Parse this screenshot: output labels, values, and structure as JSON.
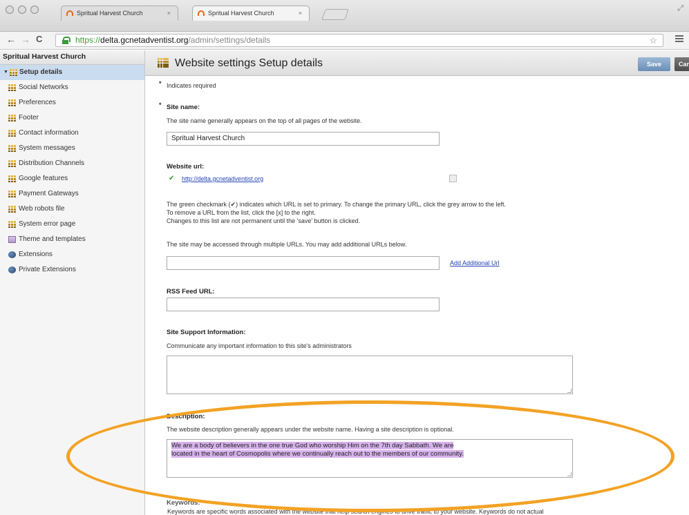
{
  "browser": {
    "tabs": [
      {
        "title": "Spritual Harvest Church",
        "close": "×"
      },
      {
        "title": "Spritual Harvest Church",
        "close": "×"
      }
    ],
    "nav": {
      "back": "←",
      "forward": "→",
      "reload": "C"
    },
    "url": {
      "scheme": "https://",
      "host": "delta.gcnetadventist.org",
      "path": "/admin/settings/details"
    },
    "bookmark_icon": "☆"
  },
  "sidebar": {
    "title": "Spritual Harvest Church",
    "expander": "▼",
    "items": [
      {
        "label": "Setup details",
        "icon": "setup-grid-icon",
        "selected": true
      },
      {
        "label": "Social Networks",
        "icon": "grid-icon"
      },
      {
        "label": "Preferences",
        "icon": "grid-icon"
      },
      {
        "label": "Footer",
        "icon": "grid-icon"
      },
      {
        "label": "Contact information",
        "icon": "grid-icon"
      },
      {
        "label": "System messages",
        "icon": "grid-icon"
      },
      {
        "label": "Distribution Channels",
        "icon": "grid-icon"
      },
      {
        "label": "Google features",
        "icon": "grid-icon"
      },
      {
        "label": "Payment Gateways",
        "icon": "grid-icon"
      },
      {
        "label": "Web robots file",
        "icon": "grid-icon"
      },
      {
        "label": "System error page",
        "icon": "grid-icon"
      },
      {
        "label": "Theme and templates",
        "icon": "theme-icon"
      },
      {
        "label": "Extensions",
        "icon": "extension-icon"
      },
      {
        "label": "Private Extensions",
        "icon": "extension-icon"
      }
    ]
  },
  "main": {
    "title": "Website settings Setup details",
    "save_label": "Save",
    "cancel_label": "Can",
    "required_mark": "*",
    "required_note": "Indicates required",
    "site_name": {
      "label": "Site name:",
      "help": "The site name generally appears on the top of all pages of the website.",
      "value": "Spritual Harvest Church"
    },
    "website_url": {
      "label": "Website url:",
      "check": "✔",
      "url": "http://delta.gcnetadventist.org",
      "help_line1": "The green checkmark (✔) indicates which URL is set to primary. To change the primary URL, click the grey arrow to the left.",
      "help_line2": "To remove a URL from the list, click the [x] to the right.",
      "help_line3": "Changes to this list are not permanent until the 'save' button is clicked.",
      "additional_help": "The site may be accessed through multiple URLs. You may add additional URLs below.",
      "additional_value": "",
      "add_link": "Add Additional Url"
    },
    "rss": {
      "label": "RSS Feed URL:",
      "value": ""
    },
    "support": {
      "label": "Site Support Information:",
      "help": "Communicate any important information to this site's administrators",
      "value": ""
    },
    "description": {
      "label": "Description:",
      "help": "The website description generally appears under the website name. Having a site description is optional.",
      "line1": "We are a body of believers in the one true God who worship Him on the 7th day Sabbath. We are",
      "line2": "located in the heart of Cosmopolis where we continually reach out to the members of our community."
    },
    "keywords": {
      "label_partial": "Keywords:",
      "help_partial": "Keywords are specific words associated with the website that help search engines to drive traffic to your website. Keywords do not actual"
    }
  },
  "annotation": {
    "color": "#f2a224"
  }
}
